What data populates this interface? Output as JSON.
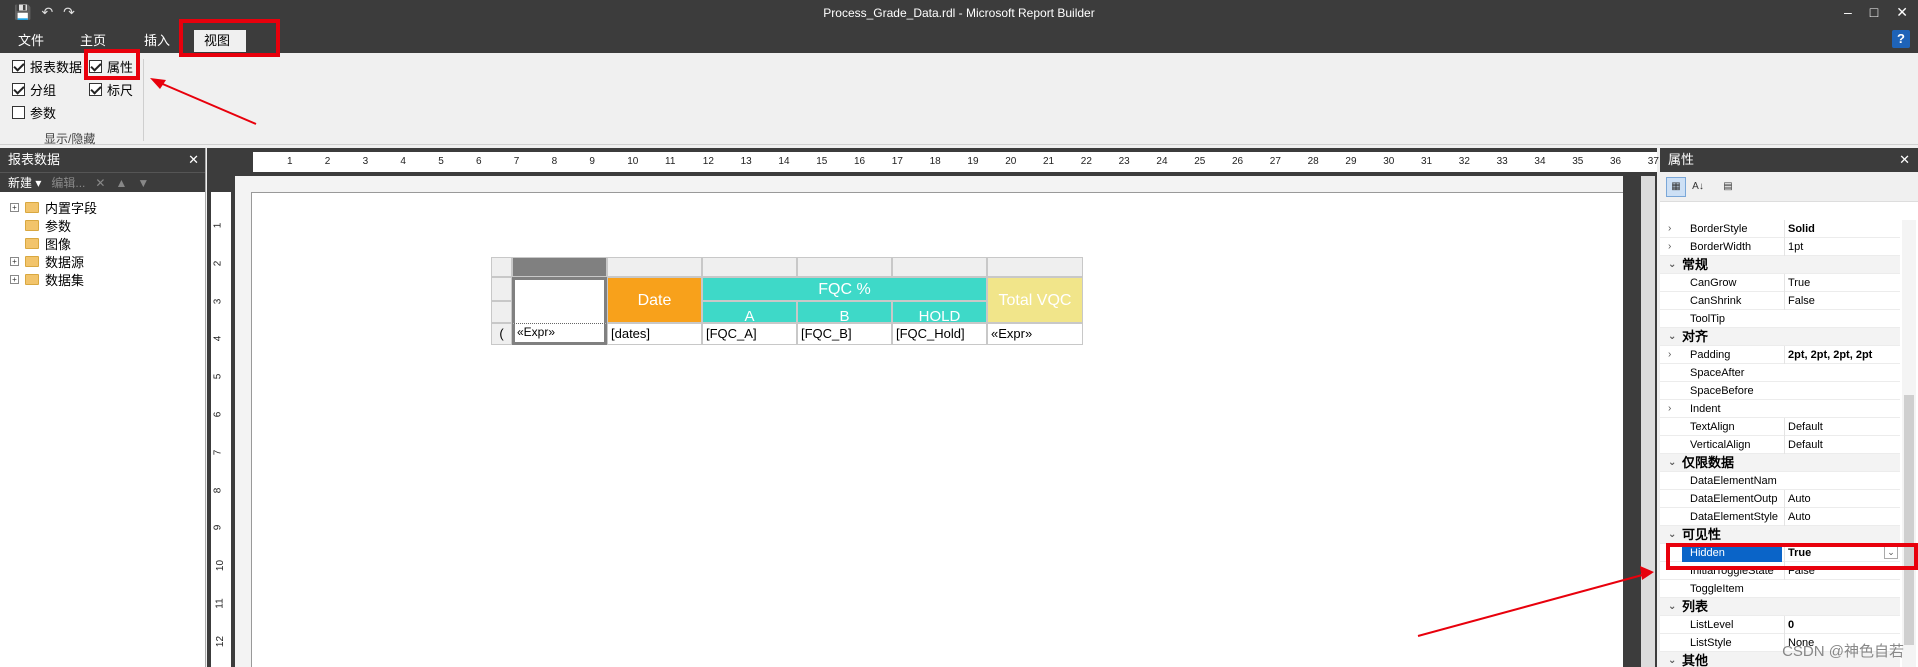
{
  "window": {
    "title": "Process_Grade_Data.rdl - Microsoft Report Builder",
    "minimize": "–",
    "maximize": "□",
    "close": "✕",
    "qat_save": "💾",
    "qat_undo": "↶",
    "qat_redo": "↷"
  },
  "ribbon_tabs": [
    {
      "label": "文件"
    },
    {
      "label": "主页"
    },
    {
      "label": "插入"
    },
    {
      "label": "视图"
    }
  ],
  "help_label": "?",
  "ribbon": {
    "checks": [
      {
        "label": "报表数据",
        "checked": true
      },
      {
        "label": "分组",
        "checked": true
      },
      {
        "label": "参数",
        "checked": false
      },
      {
        "label": "属性",
        "checked": true
      },
      {
        "label": "标尺",
        "checked": true
      }
    ],
    "group_label": "显示/隐藏"
  },
  "left_panel": {
    "title": "报表数据",
    "toolbar": {
      "new": "新建 ▾",
      "edit": "编辑..."
    },
    "tree": [
      {
        "label": "内置字段",
        "expandable": true
      },
      {
        "label": "参数",
        "expandable": false
      },
      {
        "label": "图像",
        "expandable": false
      },
      {
        "label": "数据源",
        "expandable": true
      },
      {
        "label": "数据集",
        "expandable": true
      }
    ]
  },
  "ruler": {
    "h_numbers": [
      "1",
      "2",
      "3",
      "4",
      "5",
      "6",
      "7",
      "8",
      "9",
      "10",
      "11",
      "12",
      "13",
      "14",
      "15",
      "16",
      "17",
      "18",
      "19",
      "20",
      "21",
      "22",
      "23",
      "24",
      "25",
      "26",
      "27",
      "28",
      "29",
      "30",
      "31",
      "32",
      "33",
      "34",
      "35",
      "36",
      "37"
    ],
    "v_numbers": [
      "1",
      "2",
      "3",
      "4",
      "5",
      "6",
      "7",
      "8",
      "9",
      "10",
      "11",
      "12"
    ]
  },
  "tablix": {
    "header_date": "Date",
    "header_fqc": "FQC %",
    "header_a": "A",
    "header_b": "B",
    "header_hold": "HOLD",
    "header_total": "Total VQC",
    "row_expr1": "«Expr»",
    "row_dates": "[dates]",
    "row_fqc_a": "[FQC_A]",
    "row_fqc_b": "[FQC_B]",
    "row_fqc_hold": "[FQC_Hold]",
    "row_expr2": "«Expr»",
    "row_group_marker": "(",
    "colors": {
      "date_bg": "#f8a11b",
      "fqc_bg": "#3ed9c8",
      "total_bg": "#f1e58a"
    }
  },
  "right_panel": {
    "title": "属性",
    "properties": [
      {
        "name": "BorderStyle",
        "value": "Solid",
        "bold": true,
        "expand": "›"
      },
      {
        "name": "BorderWidth",
        "value": "1pt",
        "expand": "›"
      },
      {
        "category": "常规"
      },
      {
        "name": "CanGrow",
        "value": "True"
      },
      {
        "name": "CanShrink",
        "value": "False"
      },
      {
        "name": "ToolTip",
        "value": ""
      },
      {
        "category": "对齐"
      },
      {
        "name": "Padding",
        "value": "2pt, 2pt, 2pt, 2pt",
        "bold": true,
        "expand": "›"
      },
      {
        "name": "SpaceAfter",
        "value": ""
      },
      {
        "name": "SpaceBefore",
        "value": ""
      },
      {
        "name": "Indent",
        "value": "",
        "expand": "›"
      },
      {
        "name": "TextAlign",
        "value": "Default"
      },
      {
        "name": "VerticalAlign",
        "value": "Default"
      },
      {
        "category": "仅限数据"
      },
      {
        "name": "DataElementNam",
        "value": ""
      },
      {
        "name": "DataElementOutp",
        "value": "Auto"
      },
      {
        "name": "DataElementStyle",
        "value": "Auto"
      },
      {
        "category": "可见性"
      },
      {
        "name": "Hidden",
        "value": "True",
        "selected": true
      },
      {
        "name": "InitialToggleState",
        "value": "False"
      },
      {
        "name": "ToggleItem",
        "value": ""
      },
      {
        "category": "列表"
      },
      {
        "name": "ListLevel",
        "value": "0",
        "bold": true
      },
      {
        "name": "ListStyle",
        "value": "None"
      },
      {
        "category": "其他"
      }
    ]
  },
  "watermark": "CSDN @神色自若"
}
